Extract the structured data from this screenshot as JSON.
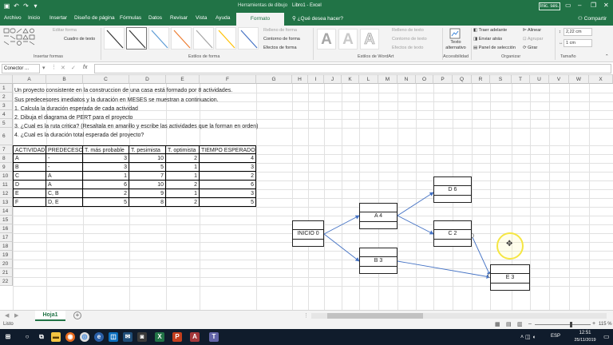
{
  "window": {
    "context_title": "Herramientas de dibujo",
    "title": "Libro1  -  Excel",
    "signin": "Inic. ses.",
    "tell_me": "¿Qué desea hacer?",
    "share": "Compartir"
  },
  "tabs": [
    "Archivo",
    "Inicio",
    "Insertar",
    "Diseño de página",
    "Fórmulas",
    "Datos",
    "Revisar",
    "Vista",
    "Ayuda",
    "Formato"
  ],
  "ribbon": {
    "editar_forma": "Editar forma",
    "cuadro_texto": "Cuadro de texto",
    "insertar_formas": "Insertar formas",
    "estilos_forma": "Estilos de forma",
    "relleno": "Relleno de forma",
    "contorno": "Contorno de forma",
    "efectos": "Efectos de forma",
    "estilos_wordart": "Estilos de WordArt",
    "relleno_texto": "Relleno de texto",
    "contorno_texto": "Contorno de texto",
    "efectos_texto": "Efectos de texto",
    "texto_alt": "Texto alternativo",
    "accesibilidad": "Accesibilidad",
    "traer": "Traer adelante",
    "enviar": "Enviar atrás",
    "panel": "Panel de selección",
    "alinear": "Alinear",
    "agrupar": "Agrupar",
    "girar": "Girar",
    "organizar": "Organizar",
    "alto": "2,22 cm",
    "ancho": "1 cm",
    "tamano": "Tamaño",
    "wordart_letter": "A"
  },
  "formula_bar": {
    "namebox": "Conector ...",
    "fx": "fx",
    "cancel": "✕",
    "enter": "✓"
  },
  "columns": [
    "A",
    "B",
    "C",
    "D",
    "E",
    "F",
    "G",
    "H",
    "I",
    "J",
    "K",
    "L",
    "M",
    "N",
    "O",
    "P",
    "Q",
    "R",
    "S",
    "T",
    "U",
    "V",
    "W",
    "X"
  ],
  "rows": [
    "1",
    "2",
    "3",
    "4",
    "5",
    "6",
    "7",
    "8",
    "9",
    "10",
    "11",
    "12",
    "13",
    "14",
    "15",
    "16",
    "17",
    "18",
    "19",
    "20",
    "21",
    "22"
  ],
  "intro": [
    "Un proyecto consistente en la construccion de una casa está formado por 8 actividades.",
    "Sus predecesores imediatos y la duración en MESES se muestran a continuacion.",
    "1. Calcula la duración esperada de cada actividad",
    "2. Dibuja el diagrama de PERT para el proyecto",
    "3. ¿Cual es la ruta critica? (Resaltala en amarillo y escribe las actividades que la forman en orden)",
    "4. ¿Cual es la duración total esperada del proyecto?"
  ],
  "table": {
    "headers": [
      "ACTIVIDAD",
      "PREDECESOR",
      "T. más probable",
      "T. pesimista",
      "T. optimista",
      "TIEMPO ESPERADO"
    ],
    "rows": [
      [
        "A",
        "-",
        "3",
        "10",
        "2",
        "4"
      ],
      [
        "B",
        "-",
        "3",
        "5",
        "1",
        "3"
      ],
      [
        "C",
        "A",
        "1",
        "7",
        "1",
        "2"
      ],
      [
        "D",
        "A",
        "6",
        "10",
        "2",
        "6"
      ],
      [
        "E",
        "C, B",
        "2",
        "9",
        "1",
        "3"
      ],
      [
        "F",
        "D, E",
        "5",
        "8",
        "2",
        "5"
      ]
    ]
  },
  "diagram": {
    "nodes": [
      "INICIO 0",
      "A 4",
      "B 3",
      "D 6",
      "C 2",
      "E 3"
    ]
  },
  "sheet": {
    "tab": "Hoja1",
    "add": "+"
  },
  "status": {
    "left": "Listo",
    "zoom": "115 %"
  },
  "taskbar": {
    "time": "12:51",
    "date": "25/11/2019",
    "lang": "ESP"
  }
}
